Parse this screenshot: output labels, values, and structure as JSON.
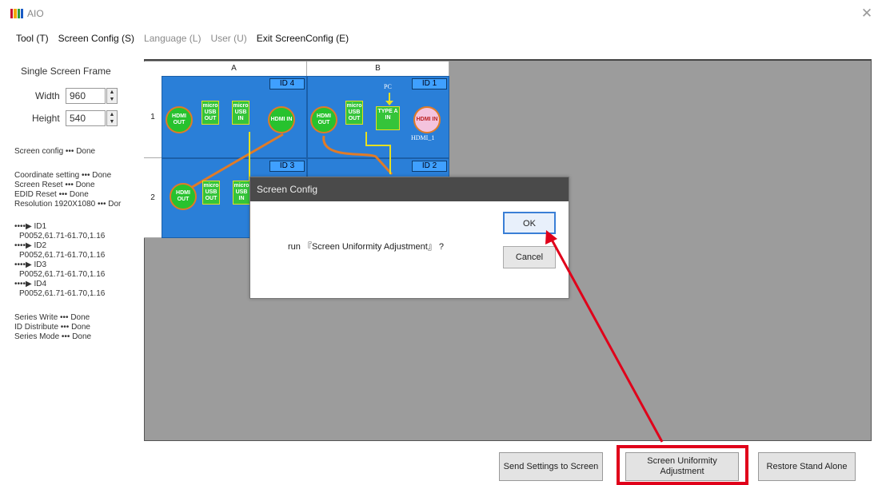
{
  "window": {
    "title": "AIO",
    "logo_colors": [
      "#c8102e",
      "#f2a800",
      "#2e9e3a",
      "#1a5cc4"
    ]
  },
  "menu": [
    {
      "label": "Tool (T)",
      "enabled": true
    },
    {
      "label": "Screen Config (S)",
      "enabled": true
    },
    {
      "label": "Language (L)",
      "enabled": false
    },
    {
      "label": "User (U)",
      "enabled": false
    },
    {
      "label": "Exit ScreenConfig (E)",
      "enabled": true
    }
  ],
  "left_panel": {
    "section_title": "Single Screen Frame",
    "width_label": "Width",
    "width_value": "960",
    "height_label": "Height",
    "height_value": "540",
    "log": [
      "Screen config ••• Done",
      "",
      "Coordinate setting ••• Done",
      "Screen Reset ••• Done",
      "EDID Reset ••• Done",
      "Resolution 1920X1080 ••• Dor",
      "",
      "••••▶ ID1",
      "P0052,61.71-61.70,1.16",
      "••••▶ ID2",
      "P0052,61.71-61.70,1.16",
      "••••▶ ID3",
      "P0052,61.71-61.70,1.16",
      "••••▶ ID4",
      "P0052,61.71-61.70,1.16",
      "",
      "Series Write ••• Done",
      "ID Distribute ••• Done",
      "Series Mode ••• Done"
    ]
  },
  "grid": {
    "columns": [
      "A",
      "B"
    ],
    "rows": [
      "1",
      "2"
    ],
    "cells": {
      "a1": {
        "id": "ID 4"
      },
      "b1": {
        "id": "ID 1"
      },
      "a2": {
        "id": "ID 3"
      },
      "b2": {
        "id": "ID 2"
      }
    },
    "ports": {
      "hdmi_out": "HDMI OUT",
      "micro_usb_out": "micro USB OUT",
      "micro_usb_in": "micro USB IN",
      "hdmi_in": "HDMI IN",
      "type_a_in": "TYPE A IN",
      "pc_label": "PC",
      "hdmi_1_label": "HDMI_1"
    },
    "colors": {
      "cell": "#2a7fd8",
      "port_green": "#27c22e",
      "wire": "#e07b27",
      "wire_yellow": "#e6e020"
    }
  },
  "dialog": {
    "title": "Screen Config",
    "message": "run 『Screen Uniformity Adjustment』 ?",
    "ok": "OK",
    "cancel": "Cancel"
  },
  "bottom_buttons": {
    "send": "Send Settings to Screen",
    "uniformity": "Screen Uniformity Adjustment",
    "restore": "Restore Stand Alone"
  },
  "annotation_color": "#e0001a"
}
